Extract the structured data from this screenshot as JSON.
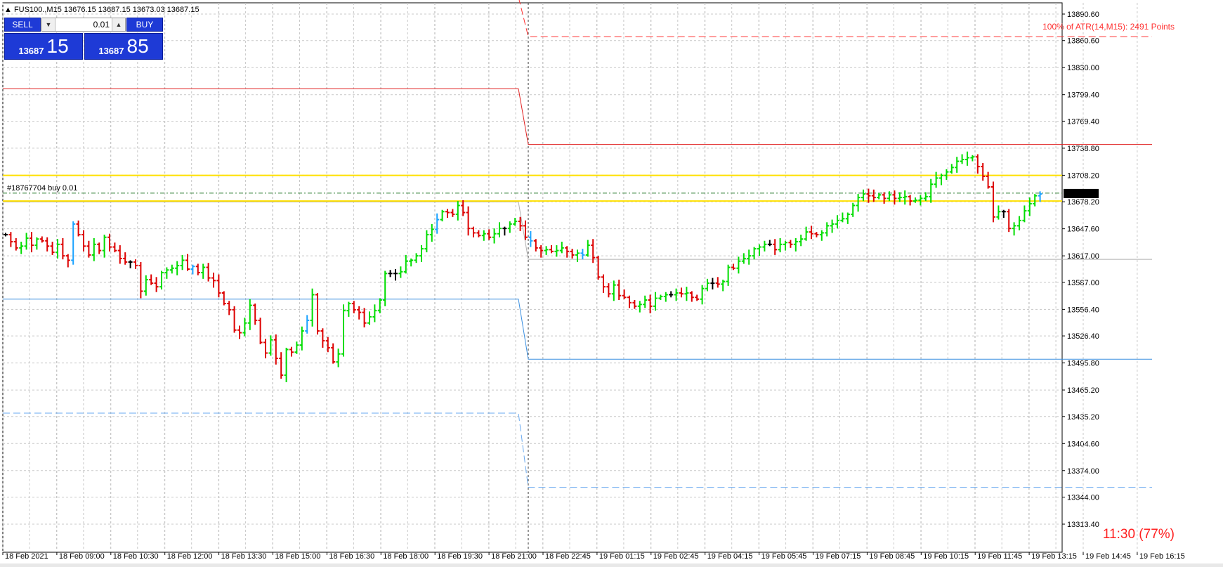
{
  "chart_data": {
    "type": "bar",
    "subtype": "ohlc",
    "symbol_header": "FUS100.,M15  13676.15 13687.15 13673.03 13687.15",
    "ylim": [
      13300,
      13900
    ],
    "y_ticks": [
      "13890.60",
      "13860.60",
      "13830.00",
      "13799.40",
      "13769.40",
      "13738.80",
      "13708.20",
      "13678.20",
      "13647.60",
      "13617.00",
      "13587.00",
      "13556.40",
      "13526.40",
      "13495.80",
      "13465.20",
      "13435.20",
      "13404.60",
      "13374.00",
      "13344.00",
      "13313.40"
    ],
    "x_ticks": [
      "18 Feb 2021",
      "18 Feb 09:00",
      "18 Feb 10:30",
      "18 Feb 12:00",
      "18 Feb 13:30",
      "18 Feb 15:00",
      "18 Feb 16:30",
      "18 Feb 18:00",
      "18 Feb 19:30",
      "18 Feb 21:00",
      "18 Feb 22:45",
      "19 Feb 01:15",
      "19 Feb 02:45",
      "19 Feb 04:15",
      "19 Feb 05:45",
      "19 Feb 07:15",
      "19 Feb 08:45",
      "19 Feb 10:15",
      "19 Feb 11:45",
      "19 Feb 13:15",
      "19 Feb 14:45",
      "19 Feb 16:15"
    ],
    "current_price_label": "13687.15",
    "current_price": 13687.15,
    "atr_label": "100% of ATR(14,M15): 2491  Points",
    "timer_label": "11:30 (77%)",
    "order_label": "#18767704 buy 0.01",
    "order_price": 13688,
    "yellow_levels": [
      13708,
      13679
    ],
    "day_separator_index": 100,
    "levels": [
      {
        "name": "red-dashed",
        "color": "#ff3030",
        "dash": true,
        "before": 13910,
        "after": 13865
      },
      {
        "name": "red-solid",
        "color": "#e02020",
        "dash": false,
        "before": 13806,
        "after": 13743
      },
      {
        "name": "gray-solid",
        "color": "#b0b0b0",
        "dash": false,
        "before": 13678,
        "after": 13613
      },
      {
        "name": "blue-solid",
        "color": "#3a8fe0",
        "dash": false,
        "before": 13568,
        "after": 13500
      },
      {
        "name": "blue-dashed",
        "color": "#6aaaf0",
        "dash": true,
        "before": 13439,
        "after": 13355
      }
    ],
    "closes": [
      13641,
      13633,
      13626,
      13628,
      13637,
      13629,
      13636,
      13634,
      13628,
      13621,
      13630,
      13617,
      13612,
      13653,
      13641,
      13628,
      13618,
      13630,
      13623,
      13638,
      13627,
      13623,
      13614,
      13610,
      13610,
      13606,
      13577,
      13590,
      13586,
      13582,
      13598,
      13601,
      13603,
      13606,
      13612,
      13602,
      13605,
      13598,
      13604,
      13592,
      13589,
      13575,
      13563,
      13556,
      13533,
      13530,
      13541,
      13561,
      13544,
      13519,
      13507,
      13522,
      13501,
      13482,
      13511,
      13508,
      13516,
      13532,
      13544,
      13573,
      13532,
      13521,
      13513,
      13497,
      13506,
      13555,
      13563,
      13556,
      13553,
      13541,
      13548,
      13555,
      13567,
      13597,
      13597,
      13597,
      13599,
      13611,
      13612,
      13617,
      13625,
      13641,
      13647,
      13658,
      13667,
      13666,
      13664,
      13674,
      13666,
      13648,
      13643,
      13640,
      13642,
      13638,
      13642,
      13648,
      13648,
      13653,
      13656,
      13651,
      13638,
      13634,
      13626,
      13623,
      13624,
      13622,
      13623,
      13626,
      13622,
      13618,
      13620,
      13618,
      13629,
      13615,
      13593,
      13582,
      13574,
      13584,
      13572,
      13570,
      13564,
      13560,
      13562,
      13567,
      13560,
      13569,
      13571,
      13573,
      13573,
      13575,
      13574,
      13575,
      13570,
      13568,
      13580,
      13586,
      13586,
      13585,
      13588,
      13604,
      13603,
      13611,
      13614,
      13617,
      13625,
      13627,
      13630,
      13630,
      13624,
      13630,
      13632,
      13630,
      13633,
      13636,
      13644,
      13642,
      13641,
      13643,
      13651,
      13653,
      13657,
      13659,
      13664,
      13674,
      13683,
      13687,
      13685,
      13683,
      13686,
      13682,
      13686,
      13682,
      13683,
      13684,
      13679,
      13680,
      13682,
      13684,
      13698,
      13705,
      13708,
      13712,
      13717,
      13724,
      13726,
      13728,
      13729,
      13718,
      13707,
      13695,
      13661,
      13667,
      13667,
      13648,
      13651,
      13657,
      13668,
      13676,
      13685,
      13687
    ],
    "colors": {
      "background": "#ffffff",
      "grid": "#c8c8c8",
      "bull": "#00dd00",
      "bear": "#dd0000",
      "neutral": "#000000",
      "special": "#1ca3ff",
      "yellow": "#ffe000",
      "panel": "#1e3ad6",
      "price_tag_bg": "#000000"
    },
    "special_bars": [
      13,
      36,
      58,
      83,
      101,
      111,
      199
    ]
  },
  "trade_panel": {
    "sell_label": "SELL",
    "buy_label": "BUY",
    "lot_value": "0.01",
    "sell_prefix": "13687",
    "sell_big": "15",
    "buy_prefix": "13687",
    "buy_big": "85"
  }
}
